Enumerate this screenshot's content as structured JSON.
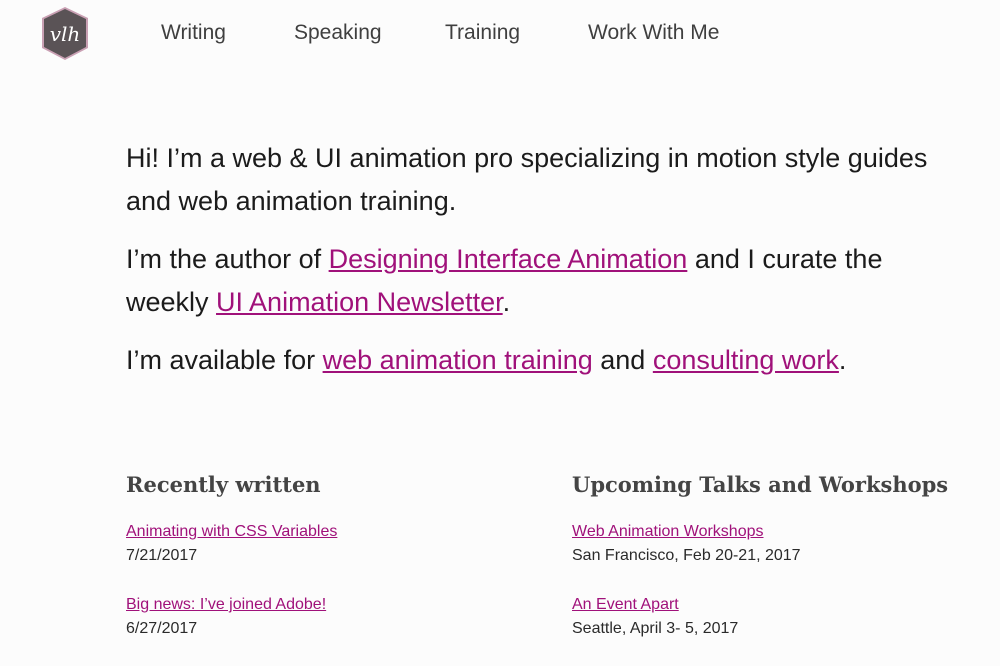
{
  "logo": {
    "text": "vlh",
    "icon": "shield-logo-icon",
    "color": "#5a5356",
    "accent": "#c9a0b3"
  },
  "nav": {
    "writing": "Writing",
    "speaking": "Speaking",
    "training": "Training",
    "work": "Work With Me"
  },
  "intro": {
    "p1": "Hi! I’m a web & UI animation pro specializing in motion style guides and web animation training.",
    "p2_pre": "I’m the author of ",
    "p2_link1": "Designing Interface Animation",
    "p2_mid": " and I curate the weekly ",
    "p2_link2": "UI Animation Newsletter",
    "p2_post": ".",
    "p3_pre": "I’m available for ",
    "p3_link1": "web animation training",
    "p3_mid": " and ",
    "p3_link2": "consulting work",
    "p3_post": "."
  },
  "recent": {
    "heading": "Recently written",
    "items": [
      {
        "title": "Animating with CSS Variables",
        "date": "7/21/2017"
      },
      {
        "title": "Big news: I’ve joined Adobe!",
        "date": "6/27/2017"
      }
    ]
  },
  "upcoming": {
    "heading": "Upcoming Talks and Workshops",
    "items": [
      {
        "title": "Web Animation Workshops",
        "detail": "San Francisco, Feb 20-21, 2017"
      },
      {
        "title": "An Event Apart",
        "detail": "Seattle, April 3- 5, 2017"
      }
    ]
  },
  "colors": {
    "link": "#a0117a",
    "text": "#1b1b1b",
    "background": "#fcfcfc"
  }
}
